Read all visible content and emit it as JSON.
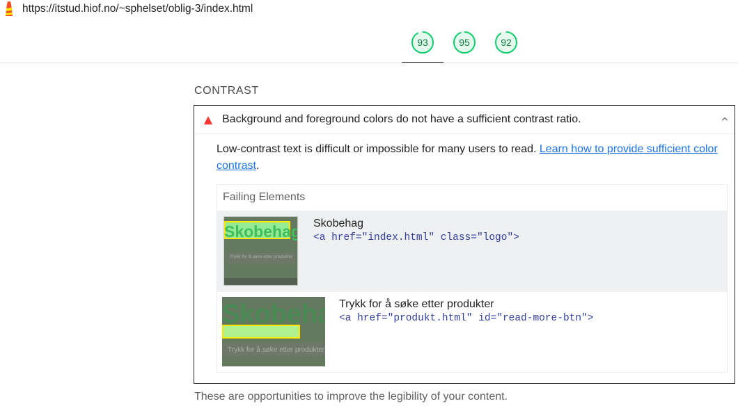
{
  "url_bar": {
    "url": "https://itstud.hiof.no/~sphelset/oblig-3/index.html",
    "icon": "lighthouse-icon"
  },
  "gauges": [
    {
      "value": "93",
      "score": 0.93,
      "color": "#0cce6b"
    },
    {
      "value": "95",
      "score": 0.95,
      "color": "#0cce6b"
    },
    {
      "value": "92",
      "score": 0.92,
      "color": "#0cce6b"
    }
  ],
  "group": {
    "title": "CONTRAST"
  },
  "audit": {
    "status_icon": "fail-triangle-icon",
    "status_color": "#ff3333",
    "title": "Background and foreground colors do not have a sufficient contrast ratio.",
    "description": "Low-contrast text is difficult or impossible for many users to read.",
    "learn_link": "Learn how to provide sufficient color contrast",
    "description_end": ".",
    "details": {
      "header": "Failing Elements",
      "items": [
        {
          "name": "Skobehag",
          "code": "<a href=\"index.html\" class=\"logo\">",
          "thumb_text": "Skobehag",
          "thumb_button_text": "Trykk for å søke etter produkter"
        },
        {
          "name": "Trykk for å søke etter produkter",
          "code": "<a href=\"produkt.html\" id=\"read-more-btn\">",
          "thumb_text": "Skobehag",
          "thumb_button_text": "Trykk for å søke etter produkter"
        }
      ]
    }
  },
  "footer": {
    "text": "These are opportunities to improve the legibility of your content."
  }
}
